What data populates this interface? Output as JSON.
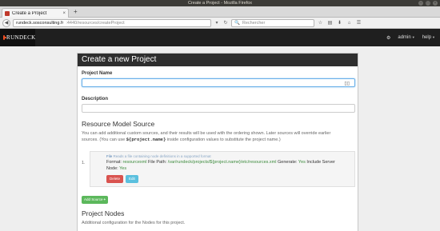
{
  "window": {
    "title": "Create a Project - Mozilla Firefox",
    "controls": [
      "–",
      "□",
      "×"
    ]
  },
  "tab": {
    "title": "Create a Project",
    "close": "×"
  },
  "toolbar": {
    "new_tab": "+",
    "back": "◀",
    "url_host": "rundeck.sosconsulting.fr",
    "url_path": ":4440/resources/createProject",
    "reload": "↻",
    "dropdown": "▾",
    "search_icon": "🔍",
    "search_placeholder": "Rechercher",
    "icons": [
      "☆",
      "▤",
      "⬇",
      "⌂",
      "☰"
    ]
  },
  "app": {
    "brand": "RUNDECK",
    "gear_icon": "⚙",
    "user": "admin",
    "help": "help",
    "accent_color": "#f04e23"
  },
  "page": {
    "heading": "Create a new Project",
    "project_name_label": "Project Name",
    "project_name_value": "",
    "description_label": "Description",
    "description_value": "",
    "resource_section_title": "Resource Model Source",
    "resource_help_1": "You can add additional custom sources, and their results will be used with the ordering shown. Later sources will override earlier",
    "resource_help_2a": "sources. (You can use",
    "resource_help_code": "${project.name}",
    "resource_help_2b": "inside configuration values to substitute the project name.)",
    "source_index": "1.",
    "source_type": "File",
    "source_desc": "Reads a file containing node definitions in a supported format",
    "format_label": "Format:",
    "format_value": "resourcexml",
    "path_label": "File Path:",
    "path_value": "/var/rundeck/projects/${project.name}/etc/resources.xml",
    "generate_label": "Generate:",
    "generate_value": "Yes",
    "include_label": "Include Server",
    "node_label": "Node:",
    "node_value": "Yes",
    "delete_label": "Delete",
    "edit_label": "Edit",
    "add_source_label": "Add Source",
    "add_source_icon": "+",
    "nodes_title": "Project Nodes",
    "nodes_help": "Additional configuration for the Nodes for this project."
  }
}
